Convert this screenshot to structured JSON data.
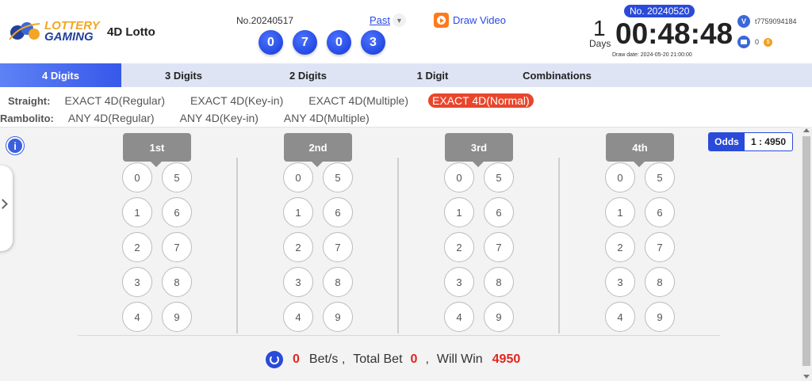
{
  "header": {
    "logo_line1": "LOTTERY",
    "logo_line2": "GAMING",
    "game_name": "4D Lotto",
    "prev_draw_no": "No.20240517",
    "prev_result": [
      "0",
      "7",
      "0",
      "3"
    ],
    "past_label": "Past",
    "draw_video_label": "Draw Video",
    "current_no": "No. 20240520",
    "days_value": "1",
    "days_label": "Days",
    "countdown": "00:48:48",
    "draw_date": "Draw date: 2024-05-20 21:00:00",
    "username": "t7759094184",
    "balance": "0"
  },
  "tabs": [
    "4 Digits",
    "3 Digits",
    "2 Digits",
    "1 Digit",
    "Combinations"
  ],
  "active_tab": "4 Digits",
  "straight": {
    "label": "Straight:",
    "items": [
      "EXACT 4D(Regular)",
      "EXACT 4D(Key-in)",
      "EXACT 4D(Multiple)",
      "EXACT 4D(Normal)"
    ],
    "active": "EXACT 4D(Normal)"
  },
  "rambolito": {
    "label": "Rambolito:",
    "items": [
      "ANY 4D(Regular)",
      "ANY 4D(Key-in)",
      "ANY 4D(Multiple)"
    ]
  },
  "odds": {
    "label": "Odds",
    "value": "1 : 4950"
  },
  "positions": [
    "1st",
    "2nd",
    "3rd",
    "4th"
  ],
  "digits": [
    "0",
    "1",
    "2",
    "3",
    "4",
    "5",
    "6",
    "7",
    "8",
    "9"
  ],
  "summary": {
    "bets": "0",
    "bets_label": "Bet/s ,",
    "total_bet_label": "Total Bet",
    "total_bet": "0",
    "separator": ",",
    "will_win_label": "Will Win",
    "will_win": "4950"
  },
  "colors": {
    "accent": "#2a4ad9",
    "active_chip": "#e8462c",
    "highlight": "#e0261f"
  }
}
